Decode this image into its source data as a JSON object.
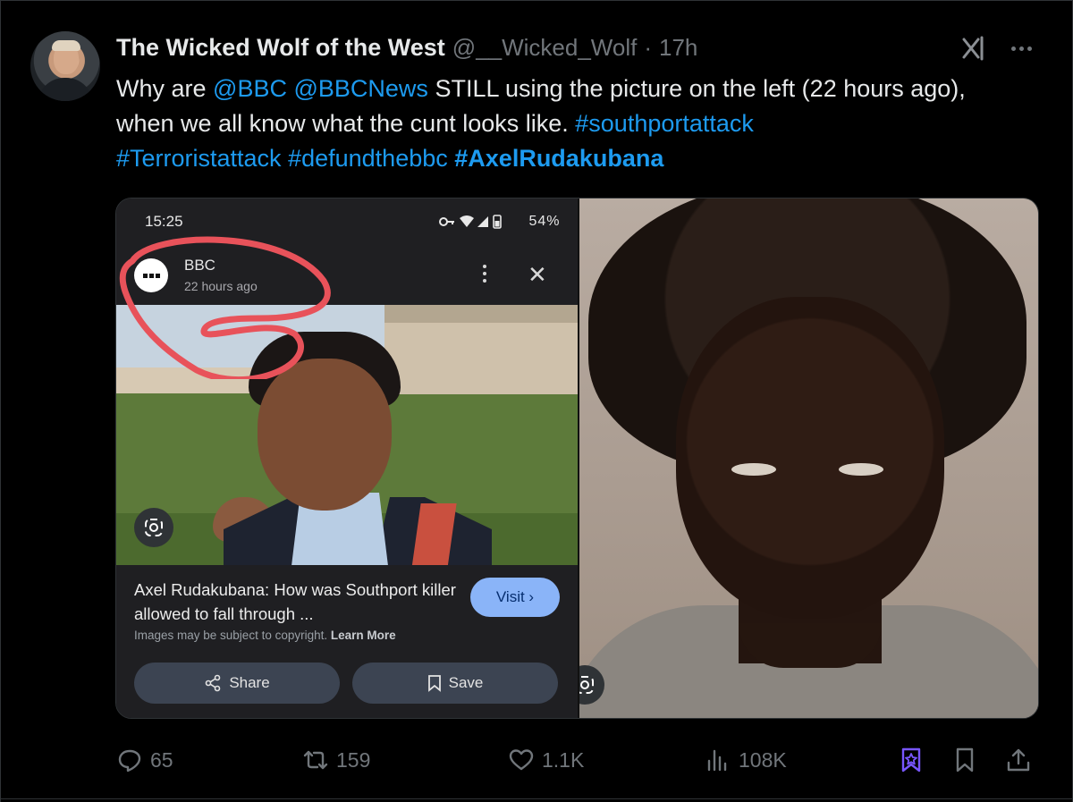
{
  "tweet": {
    "author_name": "The Wicked Wolf of the West",
    "handle": "@__Wicked_Wolf",
    "separator": "·",
    "time": "17h",
    "text": {
      "p1": "Why are ",
      "mention1": "@BBC",
      "space1": " ",
      "mention2": "@BBCNews",
      "p2": " STILL using the picture on the left (22 hours ago), when we all know what the cunt looks like. ",
      "tag1": "#southportattack",
      "tag2": "#Terroristattack",
      "space2": " ",
      "tag3": "#defundthebbc",
      "space3": " ",
      "tag4": "#AxelRudakubana"
    }
  },
  "embedded": {
    "status_time": "15:25",
    "status_battery": "54%",
    "source_name": "BBC",
    "source_time": "22 hours ago",
    "caption": "Axel Rudakubana: How was Southport killer allowed to fall through ...",
    "copyright": "Images may be subject to copyright.",
    "learn_more": "Learn More",
    "visit_label": "Visit",
    "share_label": "Share",
    "save_label": "Save"
  },
  "actions": {
    "replies": "65",
    "reposts": "159",
    "likes": "1.1K",
    "views": "108K"
  },
  "colors": {
    "link": "#1d9bf0",
    "muted": "#71767b",
    "annotation": "#e8525a",
    "visit": "#8ab4f8",
    "grok_bookmark": "#7856ff"
  }
}
